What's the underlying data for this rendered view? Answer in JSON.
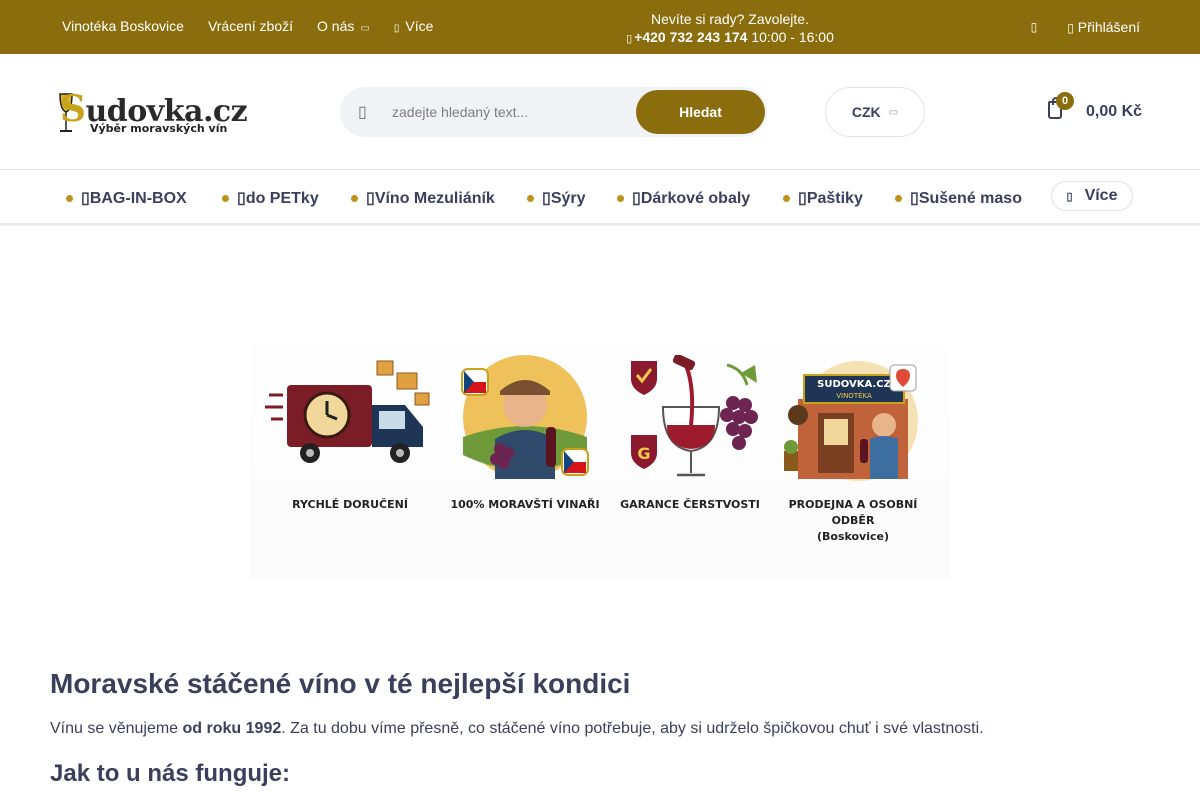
{
  "topbar": {
    "links": [
      "Vinotéka Boskovice",
      "Vrácení zboží",
      "O nás"
    ],
    "more_label": "Více",
    "callout_text": "Nevíte si rady? Zavolejte.",
    "phone": "+420 732 243 174",
    "hours": "10:00 - 16:00",
    "login_label": "Přihlášení"
  },
  "header": {
    "logo_text": "udovka.cz",
    "logo_initial": "S",
    "logo_tagline": "Výběr moravských vín",
    "search_placeholder": "zadejte hledaný text...",
    "search_button": "Hledat",
    "currency": "CZK",
    "cart_count": "0",
    "cart_total": "0,00 Kč"
  },
  "catnav": {
    "items": [
      "BAG-IN-BOX",
      "do PETky",
      "Víno Mezuliáník",
      "Sýry",
      "Dárkové obaly",
      "Paštiky",
      "Sušené maso"
    ],
    "more_label": "Více"
  },
  "banner": {
    "features": [
      {
        "label": "RYCHLÉ DORUČENÍ",
        "label2": "",
        "icon": "delivery-truck-icon"
      },
      {
        "label": "100% MORAVŠTÍ VINAŘI",
        "label2": "",
        "icon": "winemaker-icon"
      },
      {
        "label": "GARANCE ČERSTVOSTI",
        "label2": "",
        "icon": "wine-glass-icon"
      },
      {
        "label": "PRODEJNA A OSOBNÍ ODBĚR",
        "label2": "(Boskovice)",
        "icon": "shop-icon"
      }
    ],
    "shop_sign": "SUDOVKA.CZ",
    "shop_sign2": "VINOTÉKA"
  },
  "content": {
    "heading": "Moravské stáčené víno v té nejlepší kondici",
    "intro_before": "Vínu se věnujeme ",
    "intro_bold": "od roku 1992",
    "intro_after": ". Za tu dobu víme přesně, co stáčené víno potřebuje, aby si udrželo špičkovou chuť i své vlastnosti.",
    "subheading": "Jak to u nás funguje:"
  },
  "colors": {
    "brand": "#8a6d0c",
    "text": "#3a3f5c",
    "wine": "#8b1a2e",
    "grape": "#6d2450"
  }
}
